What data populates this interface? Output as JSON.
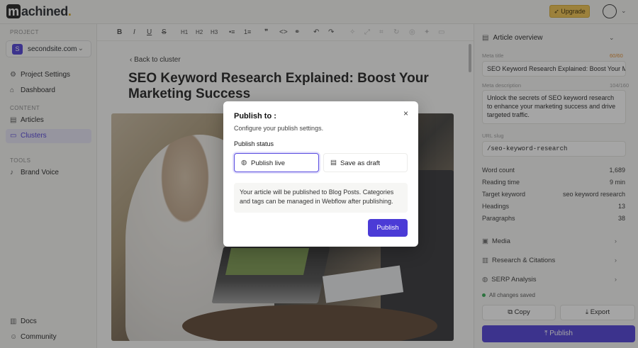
{
  "app": {
    "logo_letter": "m",
    "logo_rest": "achined",
    "logo_dot": "."
  },
  "topbar": {
    "upgrade_label": "Upgrade",
    "upgrade_icon": "rocket-icon"
  },
  "sidebar": {
    "project_label": "PROJECT",
    "project_initial": "S",
    "project_name": "secondsite.com",
    "items_top": [
      {
        "label": "Project Settings",
        "icon": "gear-icon"
      },
      {
        "label": "Dashboard",
        "icon": "home-icon"
      }
    ],
    "content_label": "CONTENT",
    "items_content": [
      {
        "label": "Articles",
        "icon": "doc-icon"
      },
      {
        "label": "Clusters",
        "icon": "folder-icon"
      }
    ],
    "tools_label": "TOOLS",
    "items_tools": [
      {
        "label": "Brand Voice",
        "icon": "mic-icon"
      }
    ],
    "items_bottom": [
      {
        "label": "Docs",
        "icon": "book-icon"
      },
      {
        "label": "Community",
        "icon": "discord-icon"
      }
    ]
  },
  "editor": {
    "toolbar": [
      "B",
      "I",
      "U",
      "S",
      "H1",
      "H2",
      "H3",
      "•≡",
      "1≡",
      "❞",
      "<>",
      "⚭",
      "↶",
      "↷"
    ],
    "back_label": "Back to cluster",
    "title": "SEO Keyword Research Explained: Boost Your Marketing Success"
  },
  "panel": {
    "header": "Article overview",
    "meta_title_label": "Meta title",
    "meta_title_count": "60/60",
    "meta_title_value": "SEO Keyword Research Explained: Boost Your Ma",
    "meta_desc_label": "Meta description",
    "meta_desc_count": "104/160",
    "meta_desc_value": "Unlock the secrets of SEO keyword research to enhance your marketing success and drive targeted traffic.",
    "url_label": "URL slug",
    "url_value": "/seo-keyword-research",
    "stats": [
      {
        "label": "Word count",
        "value": "1,689"
      },
      {
        "label": "Reading time",
        "value": "9 min"
      },
      {
        "label": "Target keyword",
        "value": "seo keyword research"
      },
      {
        "label": "Headings",
        "value": "13"
      },
      {
        "label": "Paragraphs",
        "value": "38"
      }
    ],
    "sections": [
      {
        "label": "Media",
        "icon": "image-icon"
      },
      {
        "label": "Research & Citations",
        "icon": "book-icon"
      },
      {
        "label": "SERP Analysis",
        "icon": "globe-icon"
      }
    ],
    "saved_status": "All changes saved",
    "copy_label": "Copy",
    "export_label": "Export",
    "publish_label": "Publish",
    "colors": {
      "accent": "#4b3bd6",
      "count_warn": "#e08a2b",
      "saved": "#2fa84f"
    }
  },
  "modal": {
    "title": "Publish to :",
    "subtitle": "Configure your publish settings.",
    "status_label": "Publish status",
    "option_live": "Publish live",
    "option_draft": "Save as draft",
    "info": "Your article will be published to Blog Posts. Categories and tags can be managed in Webflow after publishing.",
    "publish_button": "Publish",
    "close_icon": "×"
  }
}
